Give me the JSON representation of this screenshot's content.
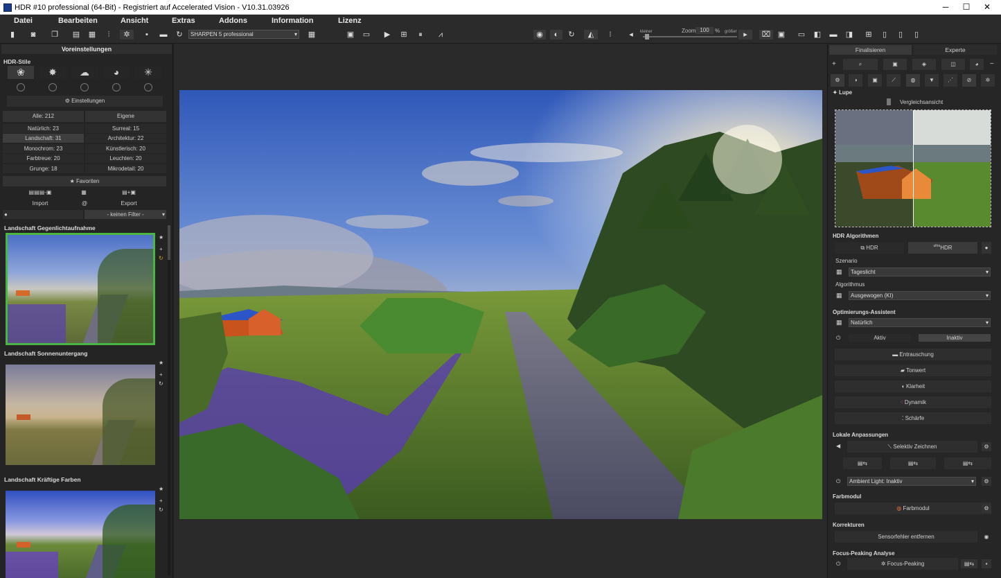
{
  "window": {
    "title": "HDR #10 professional (64-Bit) - Registriert auf Accelerated Vision - V10.31.03926",
    "controls": [
      "─",
      "☐",
      "✕"
    ]
  },
  "menu": [
    "Datei",
    "Bearbeiten",
    "Ansicht",
    "Extras",
    "Addons",
    "Information",
    "Lizenz"
  ],
  "toolbar": {
    "sharpen_preset": "SHARPEN 5 professional",
    "zoom_label": "Zoom",
    "zoom_value": "100",
    "zoom_unit": "%",
    "smaller": "kleiner",
    "larger": "größer"
  },
  "left": {
    "header": "Voreinstellungen",
    "hdr_styles": "HDR-Stile",
    "settings": "Einstellungen",
    "all": "Alle: 212",
    "own": "Eigene",
    "categories": [
      [
        "Natürlich: 23",
        "Surreal: 15"
      ],
      [
        "Landschaft: 31",
        "Architektur: 22"
      ],
      [
        "Monochrom: 23",
        "Künstlerisch: 20"
      ],
      [
        "Farbtreue: 20",
        "Leuchten: 20"
      ],
      [
        "Grunge: 18",
        "Mikrodetail: 20"
      ]
    ],
    "favorites": "★ Favoriten",
    "import": "Import",
    "at": "@",
    "export": "Export",
    "filter": "- keinen Filter -",
    "presets": [
      "Landschaft Gegenlichtaufnahme",
      "Landschaft Sonnenuntergang",
      "Landschaft Kräftige Farben"
    ]
  },
  "right": {
    "tabs": [
      "Finalisieren",
      "Experte"
    ],
    "lupe": "Lupe",
    "compare": "Vergleichsansicht",
    "hdr_alg": "HDR Algorithmen",
    "hdr_btn": "HDR",
    "ultra": "ultra",
    "ultra_hdr": "HDR",
    "scenario_label": "Szenario",
    "scenario": "Tageslicht",
    "alg_label": "Algorithmus",
    "alg": "Ausgewogen (KI)",
    "opt": "Optimierungs-Assistent",
    "opt_value": "Natürlich",
    "active": "Aktiv",
    "inactive": "Inaktiv",
    "tools": [
      "Entrauschung",
      "Tonwert",
      "Klarheit",
      "Dynamik",
      "Schärfe"
    ],
    "local": "Lokale Anpassungen",
    "selective": "Selektiv Zeichnen",
    "ambient": "Ambient Light: Inaktiv",
    "color_mod": "Farbmodul",
    "color_mod_btn": "Farbmodul",
    "corrections": "Korrekturen",
    "sensor": "Sensorfehler entfernen",
    "focus": "Focus-Peaking Analyse",
    "focus_btn": "Focus-Peaking"
  },
  "colors": {
    "accent_green": "#4bb543",
    "panel": "#262626"
  }
}
